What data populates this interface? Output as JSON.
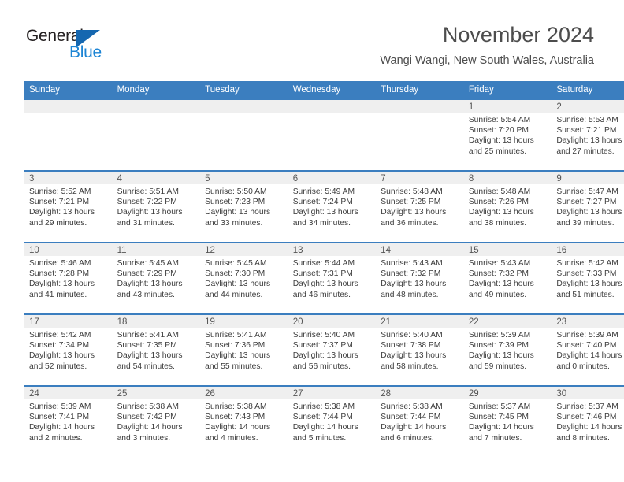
{
  "brand": {
    "name_part1": "General",
    "name_part2": "Blue",
    "triangle_color": "#1567b0",
    "text_color_blue": "#1c84d4"
  },
  "header": {
    "month_title": "November 2024",
    "location": "Wangi Wangi, New South Wales, Australia"
  },
  "theme": {
    "header_blue": "#3b7ebf",
    "daynum_band_gray": "#efefef",
    "text_gray": "#4d4d4d"
  },
  "calendar": {
    "weekday_headers": [
      "Sunday",
      "Monday",
      "Tuesday",
      "Wednesday",
      "Thursday",
      "Friday",
      "Saturday"
    ],
    "weeks": [
      [
        {
          "day": "",
          "lines": []
        },
        {
          "day": "",
          "lines": []
        },
        {
          "day": "",
          "lines": []
        },
        {
          "day": "",
          "lines": []
        },
        {
          "day": "",
          "lines": []
        },
        {
          "day": "1",
          "lines": [
            "Sunrise: 5:54 AM",
            "Sunset: 7:20 PM",
            "Daylight: 13 hours",
            "and 25 minutes."
          ]
        },
        {
          "day": "2",
          "lines": [
            "Sunrise: 5:53 AM",
            "Sunset: 7:21 PM",
            "Daylight: 13 hours",
            "and 27 minutes."
          ]
        }
      ],
      [
        {
          "day": "3",
          "lines": [
            "Sunrise: 5:52 AM",
            "Sunset: 7:21 PM",
            "Daylight: 13 hours",
            "and 29 minutes."
          ]
        },
        {
          "day": "4",
          "lines": [
            "Sunrise: 5:51 AM",
            "Sunset: 7:22 PM",
            "Daylight: 13 hours",
            "and 31 minutes."
          ]
        },
        {
          "day": "5",
          "lines": [
            "Sunrise: 5:50 AM",
            "Sunset: 7:23 PM",
            "Daylight: 13 hours",
            "and 33 minutes."
          ]
        },
        {
          "day": "6",
          "lines": [
            "Sunrise: 5:49 AM",
            "Sunset: 7:24 PM",
            "Daylight: 13 hours",
            "and 34 minutes."
          ]
        },
        {
          "day": "7",
          "lines": [
            "Sunrise: 5:48 AM",
            "Sunset: 7:25 PM",
            "Daylight: 13 hours",
            "and 36 minutes."
          ]
        },
        {
          "day": "8",
          "lines": [
            "Sunrise: 5:48 AM",
            "Sunset: 7:26 PM",
            "Daylight: 13 hours",
            "and 38 minutes."
          ]
        },
        {
          "day": "9",
          "lines": [
            "Sunrise: 5:47 AM",
            "Sunset: 7:27 PM",
            "Daylight: 13 hours",
            "and 39 minutes."
          ]
        }
      ],
      [
        {
          "day": "10",
          "lines": [
            "Sunrise: 5:46 AM",
            "Sunset: 7:28 PM",
            "Daylight: 13 hours",
            "and 41 minutes."
          ]
        },
        {
          "day": "11",
          "lines": [
            "Sunrise: 5:45 AM",
            "Sunset: 7:29 PM",
            "Daylight: 13 hours",
            "and 43 minutes."
          ]
        },
        {
          "day": "12",
          "lines": [
            "Sunrise: 5:45 AM",
            "Sunset: 7:30 PM",
            "Daylight: 13 hours",
            "and 44 minutes."
          ]
        },
        {
          "day": "13",
          "lines": [
            "Sunrise: 5:44 AM",
            "Sunset: 7:31 PM",
            "Daylight: 13 hours",
            "and 46 minutes."
          ]
        },
        {
          "day": "14",
          "lines": [
            "Sunrise: 5:43 AM",
            "Sunset: 7:32 PM",
            "Daylight: 13 hours",
            "and 48 minutes."
          ]
        },
        {
          "day": "15",
          "lines": [
            "Sunrise: 5:43 AM",
            "Sunset: 7:32 PM",
            "Daylight: 13 hours",
            "and 49 minutes."
          ]
        },
        {
          "day": "16",
          "lines": [
            "Sunrise: 5:42 AM",
            "Sunset: 7:33 PM",
            "Daylight: 13 hours",
            "and 51 minutes."
          ]
        }
      ],
      [
        {
          "day": "17",
          "lines": [
            "Sunrise: 5:42 AM",
            "Sunset: 7:34 PM",
            "Daylight: 13 hours",
            "and 52 minutes."
          ]
        },
        {
          "day": "18",
          "lines": [
            "Sunrise: 5:41 AM",
            "Sunset: 7:35 PM",
            "Daylight: 13 hours",
            "and 54 minutes."
          ]
        },
        {
          "day": "19",
          "lines": [
            "Sunrise: 5:41 AM",
            "Sunset: 7:36 PM",
            "Daylight: 13 hours",
            "and 55 minutes."
          ]
        },
        {
          "day": "20",
          "lines": [
            "Sunrise: 5:40 AM",
            "Sunset: 7:37 PM",
            "Daylight: 13 hours",
            "and 56 minutes."
          ]
        },
        {
          "day": "21",
          "lines": [
            "Sunrise: 5:40 AM",
            "Sunset: 7:38 PM",
            "Daylight: 13 hours",
            "and 58 minutes."
          ]
        },
        {
          "day": "22",
          "lines": [
            "Sunrise: 5:39 AM",
            "Sunset: 7:39 PM",
            "Daylight: 13 hours",
            "and 59 minutes."
          ]
        },
        {
          "day": "23",
          "lines": [
            "Sunrise: 5:39 AM",
            "Sunset: 7:40 PM",
            "Daylight: 14 hours",
            "and 0 minutes."
          ]
        }
      ],
      [
        {
          "day": "24",
          "lines": [
            "Sunrise: 5:39 AM",
            "Sunset: 7:41 PM",
            "Daylight: 14 hours",
            "and 2 minutes."
          ]
        },
        {
          "day": "25",
          "lines": [
            "Sunrise: 5:38 AM",
            "Sunset: 7:42 PM",
            "Daylight: 14 hours",
            "and 3 minutes."
          ]
        },
        {
          "day": "26",
          "lines": [
            "Sunrise: 5:38 AM",
            "Sunset: 7:43 PM",
            "Daylight: 14 hours",
            "and 4 minutes."
          ]
        },
        {
          "day": "27",
          "lines": [
            "Sunrise: 5:38 AM",
            "Sunset: 7:44 PM",
            "Daylight: 14 hours",
            "and 5 minutes."
          ]
        },
        {
          "day": "28",
          "lines": [
            "Sunrise: 5:38 AM",
            "Sunset: 7:44 PM",
            "Daylight: 14 hours",
            "and 6 minutes."
          ]
        },
        {
          "day": "29",
          "lines": [
            "Sunrise: 5:37 AM",
            "Sunset: 7:45 PM",
            "Daylight: 14 hours",
            "and 7 minutes."
          ]
        },
        {
          "day": "30",
          "lines": [
            "Sunrise: 5:37 AM",
            "Sunset: 7:46 PM",
            "Daylight: 14 hours",
            "and 8 minutes."
          ]
        }
      ]
    ]
  }
}
